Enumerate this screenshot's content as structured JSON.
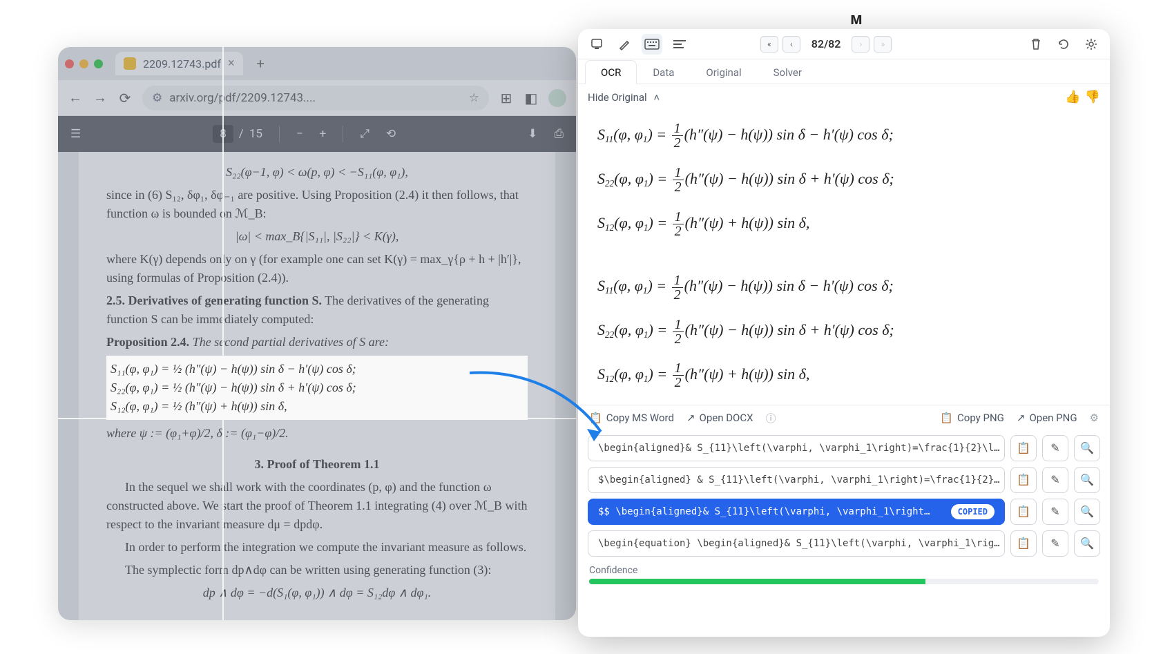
{
  "browser": {
    "tab_title": "2209.12743.pdf",
    "url": "arxiv.org/pdf/2209.12743....",
    "traffic_colors": [
      "#ff5f57",
      "#febc2e",
      "#28c840"
    ],
    "page_current": "8",
    "page_total": "15"
  },
  "pdf": {
    "top_line": "S₂₂(φ−1, φ) < ω(p, φ) < −S₁₁(φ, φ₁),",
    "para1": "since in (6)  S₁₂, δφ₁, δφ₋₁  are positive.  Using Proposition (2.4) it then follows, that function ω is bounded on  ℳ_B:",
    "eq_bound": "|ω| < max_B{|S₁₁|, |S₂₂|} < K(γ),",
    "para2": "where K(γ) depends only on γ (for example one can set K(γ) = max_γ{ρ + h + |h′|}, using formulas of Proposition (2.4)).",
    "sec25_head": "2.5.  Derivatives of generating function S.",
    "sec25_rest": "The derivatives of the generating function S can be immediately computed:",
    "prop24": "Proposition 2.4.",
    "prop24_rest": "The second partial derivatives of S are:",
    "eq1": "S₁₁(φ, φ₁) = ½ (h″(ψ) − h(ψ)) sin δ − h′(ψ) cos δ;",
    "eq2": "S₂₂(φ, φ₁) = ½ (h″(ψ) − h(ψ)) sin δ + h′(ψ) cos δ;",
    "eq3": "S₁₂(φ, φ₁) = ½ (h″(ψ) + h(ψ)) sin δ,",
    "where_line": "where ψ := (φ₁+φ)/2,   δ := (φ₁−φ)/2.",
    "sec3": "3.  Proof of Theorem 1.1",
    "body2a": "In the sequel we shall work with the coordinates (p, φ) and the function ω constructed above.  We start the proof of Theorem 1.1 integrating (4) over ℳ_B with respect to the invariant measure dμ = dpdφ.",
    "body2b": "In order to perform the integration we compute the invariant measure as follows.",
    "body2c": "The symplectic form dp∧dφ can be written using generating function (3):",
    "eq_sym": "dp ∧ dφ = −d(S₁(φ, φ₁)) ∧ dφ = S₁₂dφ ∧ dφ₁."
  },
  "panel": {
    "nav": {
      "page": "82/82"
    },
    "tabs": {
      "ocr": "OCR",
      "data": "Data",
      "original": "Original",
      "solver": "Solver"
    },
    "hide_original": "Hide Original",
    "math": {
      "row1": "S₁₁(φ, φ₁) = ½ (h″(ψ) − h(ψ)) sin δ − h′(ψ) cos δ;",
      "row2": "S₂₂(φ, φ₁) = ½ (h″(ψ) − h(ψ)) sin δ + h′(ψ) cos δ;",
      "row3": "S₁₂(φ, φ₁) = ½ (h″(ψ) + h(ψ)) sin δ,",
      "row4": "S₁₁(φ, φ₁) = ½ (h″(ψ) − h(ψ)) sin δ − h′(ψ) cos δ;",
      "row5": "S₂₂(φ, φ₁) = ½ (h″(ψ) − h(ψ)) sin δ + h′(ψ) cos δ;",
      "row6": "S₁₂(φ, φ₁) = ½ (h″(ψ) + h(ψ)) sin δ,"
    },
    "actions": {
      "copy_word": "Copy MS Word",
      "open_docx": "Open DOCX",
      "copy_png": "Copy PNG",
      "open_png": "Open PNG"
    },
    "latex": {
      "r1": "\\begin{aligned}& S_{11}\\left(\\varphi, \\varphi_1\\right)=\\frac{1}{2}\\l…",
      "r2": "$\\begin{aligned} & S_{11}\\left(\\varphi, \\varphi_1\\right)=\\frac{1}{2}…",
      "r3": "$$ \\begin{aligned}& S_{11}\\left(\\varphi, \\varphi_1\\right…",
      "r4": "\\begin{equation} \\begin{aligned}& S_{11}\\left(\\varphi, \\varphi_1\\rig…",
      "copied": "COPIED"
    },
    "confidence_label": "Confidence"
  },
  "logo": "ᴹ"
}
